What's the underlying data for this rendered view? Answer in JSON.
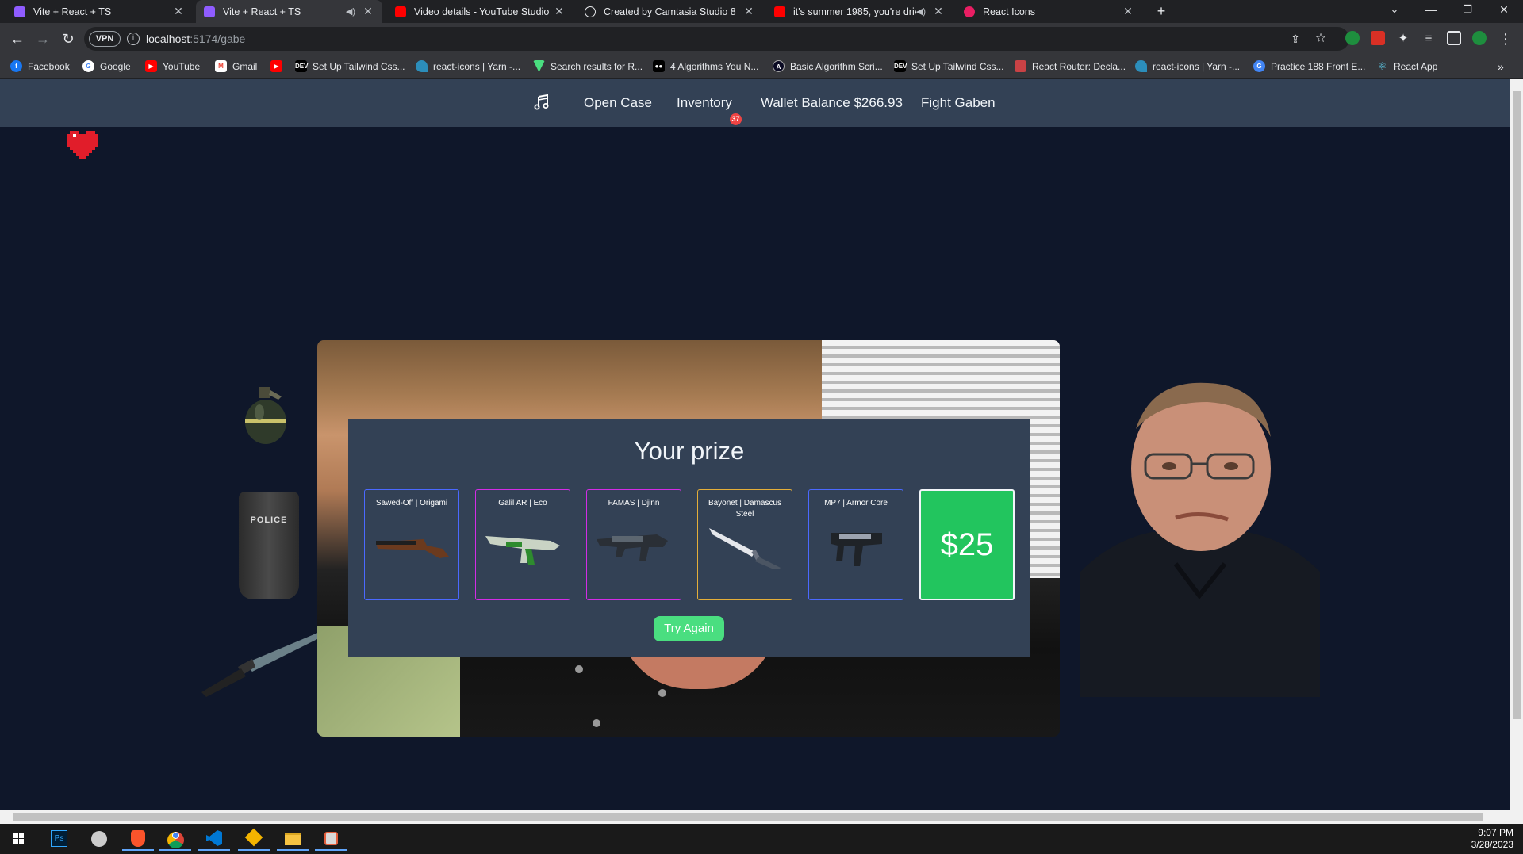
{
  "browser": {
    "tabs": [
      {
        "title": "Vite + React + TS",
        "active": false
      },
      {
        "title": "Vite + React + TS",
        "active": true
      },
      {
        "title": "Video details - YouTube Studio",
        "active": false
      },
      {
        "title": "Created by Camtasia Studio 8",
        "active": false
      },
      {
        "title": "it's summer 1985, you're driv",
        "active": false
      },
      {
        "title": "React Icons",
        "active": false
      }
    ],
    "address": {
      "host": "localhost",
      "path": ":5174/gabe",
      "vpn_label": "VPN"
    },
    "bookmarks": [
      "Facebook",
      "Google",
      "YouTube",
      "Gmail",
      "",
      "Set Up Tailwind Css...",
      "react-icons | Yarn -...",
      "Search results for R...",
      "4 Algorithms You N...",
      "Basic Algorithm Scri...",
      "Set Up Tailwind Css...",
      "React Router: Decla...",
      "react-icons | Yarn -...",
      "Practice 188 Front E...",
      "React App"
    ]
  },
  "nav": {
    "items": [
      "Open Case",
      "Inventory",
      "Wallet Balance $266.93",
      "Fight Gaben"
    ],
    "inventory_count": "37",
    "music_icon": "music-note-icon"
  },
  "prize": {
    "title": "Your prize",
    "items": [
      {
        "name": "Sawed-Off | Origami",
        "border": "#4b69ff"
      },
      {
        "name": "Galil AR | Eco",
        "border": "#d32ce6"
      },
      {
        "name": "FAMAS | Djinn",
        "border": "#d32ce6"
      },
      {
        "name": "Bayonet | Damascus Steel",
        "border": "#e4ae39"
      },
      {
        "name": "MP7 | Armor Core",
        "border": "#4b69ff"
      }
    ],
    "cash": "$25",
    "try_again": "Try Again"
  },
  "colors": {
    "page_bg": "#0f172a",
    "nav_bg": "#334155",
    "panel_bg": "#334155",
    "cash_green": "#22c55e",
    "button_green": "#4ade80"
  },
  "side_icons": [
    "grenade-icon",
    "riot-shield-icon",
    "knife-icon",
    "heart-icon"
  ],
  "riot_shield_text": "POLICE",
  "taskbar": {
    "time": "9:07 PM",
    "date": "3/28/2023"
  }
}
